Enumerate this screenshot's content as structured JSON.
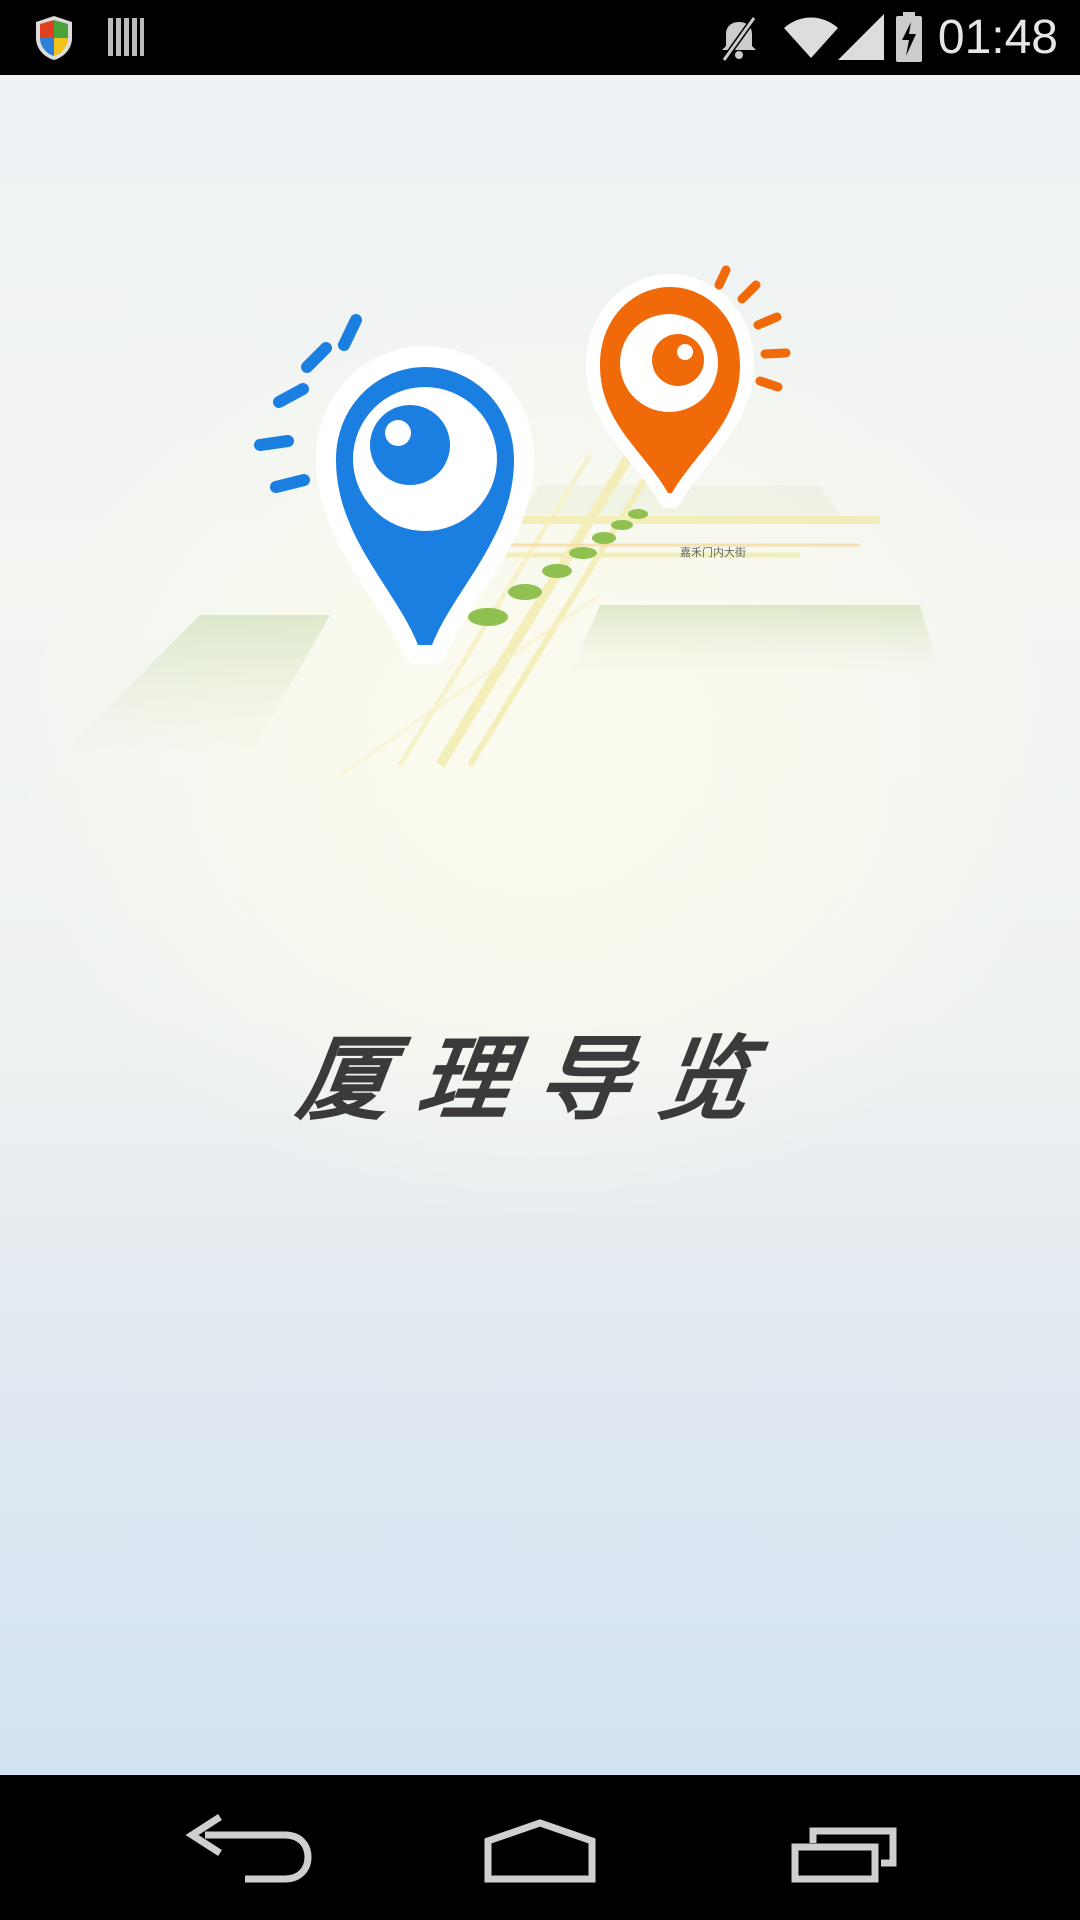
{
  "status_bar": {
    "time": "01:48",
    "icons": [
      "security-shield-icon",
      "barcode-icon",
      "mute-icon",
      "wifi-icon",
      "signal-icon",
      "battery-charging-icon"
    ]
  },
  "splash": {
    "title": "厦理导览",
    "map_street_label": "嘉禾门内大街",
    "colors": {
      "blue_pin": "#1a7fe0",
      "orange_pin": "#f06a0a",
      "route": "#8fc050"
    }
  },
  "nav_bar": {
    "icons": [
      "back-icon",
      "home-icon",
      "recent-apps-icon"
    ]
  }
}
